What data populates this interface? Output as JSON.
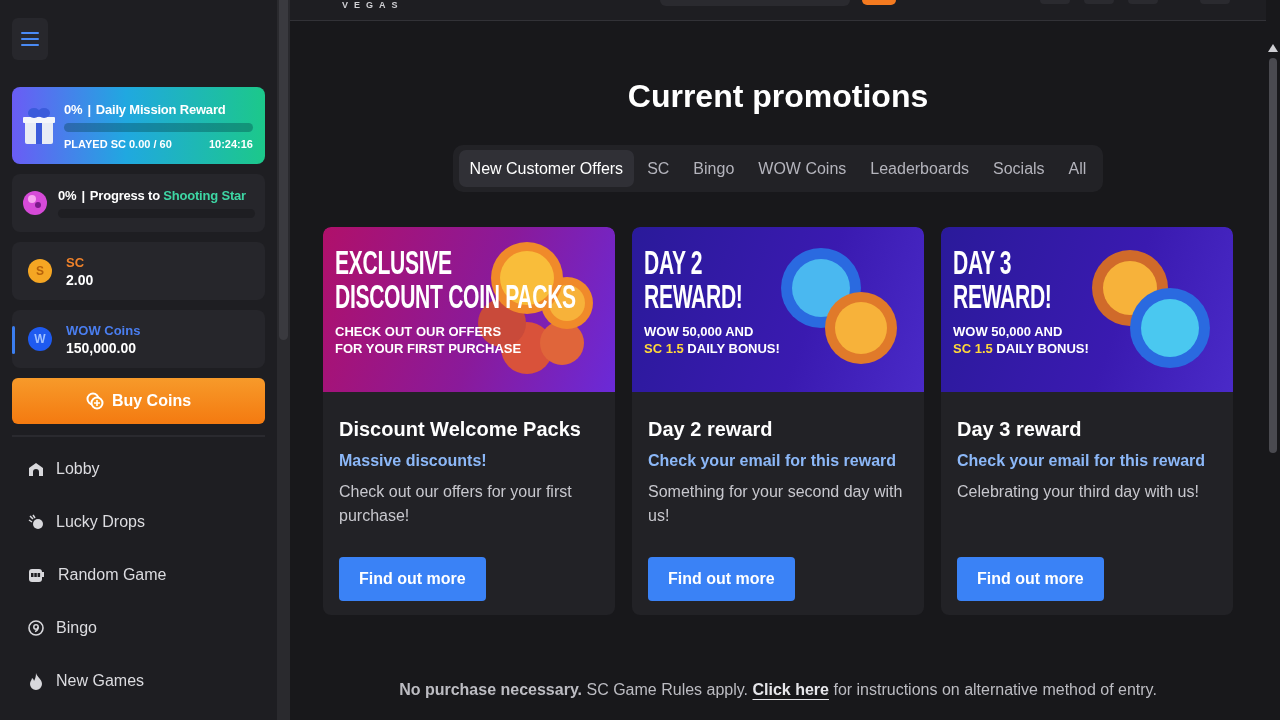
{
  "header": {
    "logo_text": "VEGAS"
  },
  "sidebar": {
    "mission": {
      "percent": "0%",
      "separator": "|",
      "title": "Daily Mission Reward",
      "level": 0,
      "played": "PLAYED SC 0.00 / 60",
      "timer": "10:24:16"
    },
    "progress": {
      "percent": "0%",
      "separator": "|",
      "label": "Progress to",
      "highlight": "Shooting Star",
      "level": 0
    },
    "balances": [
      {
        "kind": "sc",
        "symbol": "S",
        "label": "SC",
        "amount": "2.00",
        "selected": false
      },
      {
        "kind": "wow",
        "symbol": "W",
        "label": "WOW Coins",
        "amount": "150,000.00",
        "selected": true
      }
    ],
    "buy_button": "Buy Coins",
    "nav": [
      {
        "label": "Lobby"
      },
      {
        "label": "Lucky Drops"
      },
      {
        "label": "Random Game"
      },
      {
        "label": "Bingo"
      },
      {
        "label": "New Games"
      }
    ]
  },
  "main": {
    "title": "Current promotions",
    "tabs": [
      {
        "label": "New Customer Offers",
        "selected": true
      },
      {
        "label": "SC",
        "selected": false
      },
      {
        "label": "Bingo",
        "selected": false
      },
      {
        "label": "WOW Coins",
        "selected": false
      },
      {
        "label": "Leaderboards",
        "selected": false
      },
      {
        "label": "Socials",
        "selected": false
      },
      {
        "label": "All",
        "selected": false
      }
    ],
    "cards": [
      {
        "banner": {
          "kind": "discount",
          "headline": [
            "EXCLUSIVE",
            "DISCOUNT COIN PACKS"
          ],
          "sub": [
            "CHECK OUT OUR OFFERS",
            "FOR YOUR FIRST PURCHASE"
          ]
        },
        "title": "Discount Welcome Packs",
        "subtitle": "Massive discounts!",
        "text": "Check out our offers for your first purchase!",
        "button": "Find out more"
      },
      {
        "banner": {
          "kind": "daily",
          "headline": [
            "DAY 2",
            "REWARD!"
          ],
          "sub": [
            "WOW 50,000 AND",
            "**SC 1.5** DAILY BONUS!"
          ]
        },
        "title": "Day 2 reward",
        "subtitle": "Check your email for this reward",
        "text": "Something for your second day with us!",
        "button": "Find out more"
      },
      {
        "banner": {
          "kind": "daily",
          "headline": [
            "DAY 3",
            "REWARD!"
          ],
          "sub": [
            "WOW 50,000 AND",
            "**SC 1.5** DAILY BONUS!"
          ]
        },
        "title": "Day 3 reward",
        "subtitle": "Check your email for this reward",
        "text": "Celebrating your third day with us!",
        "button": "Find out more"
      }
    ],
    "footer": {
      "lead": "**No purchase necessary.** SC Game Rules apply.",
      "link": "Click here",
      "tail": "for instructions on alternative method of entry."
    }
  }
}
